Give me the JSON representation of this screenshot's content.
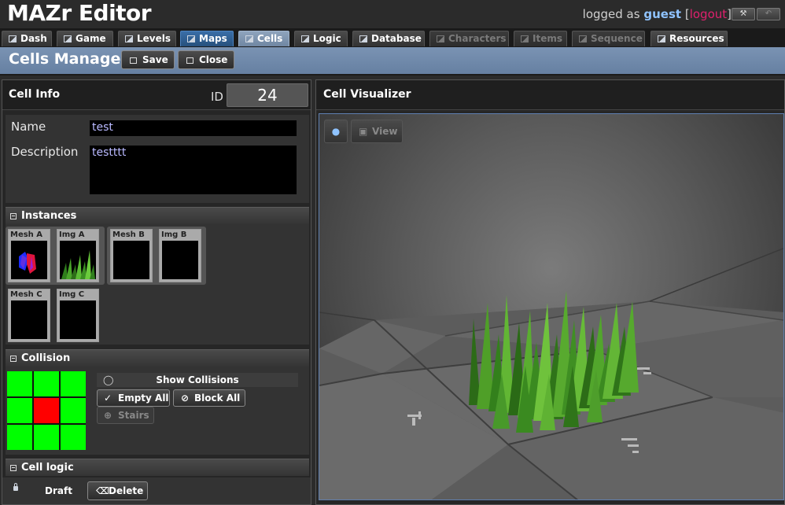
{
  "app": {
    "title": "MAZr Editor",
    "logged_as": "logged as",
    "user": "guest",
    "logout_open": "[",
    "logout": "logout",
    "logout_close": "]",
    "tools_icon": "wrench-icon",
    "back_icon": "undo-icon"
  },
  "tabs": [
    {
      "label": "Dash",
      "state": "normal"
    },
    {
      "label": "Game",
      "state": "normal"
    },
    {
      "label": "Levels",
      "state": "normal"
    },
    {
      "label": "Maps",
      "state": "highlight"
    },
    {
      "label": "Cells",
      "state": "active"
    },
    {
      "label": "Logic",
      "state": "normal"
    },
    {
      "label": "Database",
      "state": "normal"
    },
    {
      "label": "Characters",
      "state": "disabled"
    },
    {
      "label": "Items",
      "state": "disabled"
    },
    {
      "label": "Sequence",
      "state": "disabled"
    },
    {
      "label": "Resources",
      "state": "normal"
    }
  ],
  "manager": {
    "title": "Cells Manager",
    "save_label": "Save",
    "close_label": "Close"
  },
  "cell_info": {
    "title": "Cell Info",
    "id_label": "ID",
    "id_value": "24",
    "name_label": "Name",
    "name_value": "test",
    "description_label": "Description",
    "description_value": "testttt"
  },
  "instances": {
    "title": "Instances",
    "items": [
      {
        "label": "Mesh A"
      },
      {
        "label": "Img A"
      },
      {
        "label": "Mesh B"
      },
      {
        "label": "Img B"
      },
      {
        "label": "Mesh C"
      },
      {
        "label": "Img C"
      }
    ]
  },
  "collision": {
    "title": "Collision",
    "grid": [
      [
        "open",
        "open",
        "open"
      ],
      [
        "open",
        "block",
        "open"
      ],
      [
        "open",
        "open",
        "open"
      ]
    ],
    "show_label": "Show Collisions",
    "empty_label": "Empty All",
    "block_label": "Block All",
    "stairs_label": "Stairs"
  },
  "cell_logic": {
    "title": "Cell logic"
  },
  "footer": {
    "draft_label": "Draft",
    "delete_label": "Delete"
  },
  "visualizer": {
    "title": "Cell Visualizer",
    "view_label": "View"
  },
  "colors": {
    "accent": "#6680a2",
    "collision_open": "#00ff00",
    "collision_block": "#ff0000",
    "user": "#8fc3ff",
    "logout": "#e0206e"
  }
}
